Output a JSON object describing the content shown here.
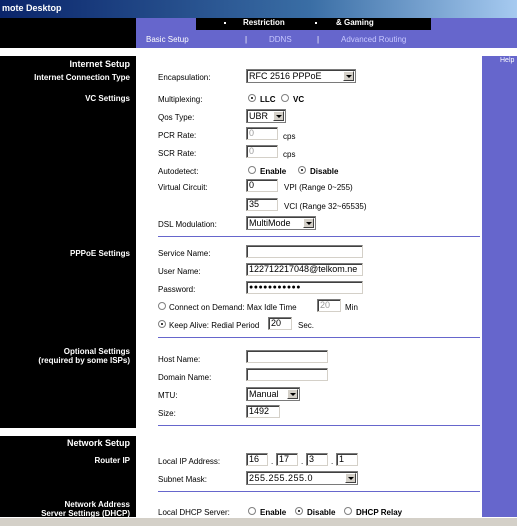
{
  "window": {
    "title": "mote Desktop"
  },
  "nav": {
    "tabs": [
      "Restriction",
      "& Gaming"
    ],
    "subtabs": [
      "Basic Setup",
      "DDNS",
      "Advanced Routing"
    ],
    "separators": [
      "|",
      "|"
    ]
  },
  "left": {
    "internet_setup": "Internet Setup",
    "internet_connection_type": "Internet Connection Type",
    "vc_settings": "VC Settings",
    "pppoe_settings": "PPPoE Settings",
    "optional_settings": "Optional Settings",
    "optional_settings_note": "(required by some ISPs)",
    "network_setup": "Network Setup",
    "router_ip": "Router IP",
    "network_address": "Network Address",
    "server_settings": "Server Settings (DHCP)"
  },
  "help": {
    "label": "Help"
  },
  "form": {
    "encapsulation": {
      "label": "Encapsulation:",
      "value": "RFC 2516 PPPoE"
    },
    "multiplexing": {
      "label": "Multiplexing:",
      "option_llc": "LLC",
      "option_vc": "VC",
      "selected": "LLC"
    },
    "qos_type": {
      "label": "Qos Type:",
      "value": "UBR"
    },
    "pcr_rate": {
      "label": "PCR Rate:",
      "value": "0",
      "unit": "cps"
    },
    "scr_rate": {
      "label": "SCR Rate:",
      "value": "0",
      "unit": "cps"
    },
    "autodetect": {
      "label": "Autodetect:",
      "option_enable": "Enable",
      "option_disable": "Disable",
      "selected": "Disable"
    },
    "virtual_circuit": {
      "label": "Virtual Circuit:",
      "vpi": "0",
      "vpi_hint": "VPI (Range 0~255)",
      "vci": "35",
      "vci_hint": "VCI (Range 32~65535)"
    },
    "dsl_modulation": {
      "label": "DSL Modulation:",
      "value": "MultiMode"
    },
    "service_name": {
      "label": "Service Name:",
      "value": ""
    },
    "user_name": {
      "label": "User Name:",
      "value": "122712217048@telkom.ne"
    },
    "password": {
      "label": "Password:",
      "value": "●●●●●●●●●●●"
    },
    "connect_on_demand": {
      "label": "Connect on Demand: Max Idle Time",
      "value": "20",
      "unit": "Min",
      "selected": false
    },
    "keep_alive": {
      "label": "Keep Alive: Redial Period",
      "value": "20",
      "unit": "Sec.",
      "selected": true
    },
    "host_name": {
      "label": "Host Name:",
      "value": ""
    },
    "domain_name": {
      "label": "Domain Name:",
      "value": ""
    },
    "mtu": {
      "label": "MTU:",
      "value": "Manual"
    },
    "size": {
      "label": "Size:",
      "value": "1492"
    },
    "local_ip": {
      "label": "Local IP Address:",
      "octets": [
        "16",
        "17",
        "3",
        "1"
      ],
      "dot": "."
    },
    "subnet_mask": {
      "label": "Subnet Mask:",
      "value": "255.255.255.0"
    },
    "local_dhcp": {
      "label": "Local DHCP Server:",
      "option_enable": "Enable",
      "option_disable": "Disable",
      "option_relay": "DHCP Relay",
      "selected": "Disable"
    }
  },
  "colors": {
    "accent": "#6666cc",
    "panel": "#000000",
    "titlebar": "#0a246a"
  }
}
